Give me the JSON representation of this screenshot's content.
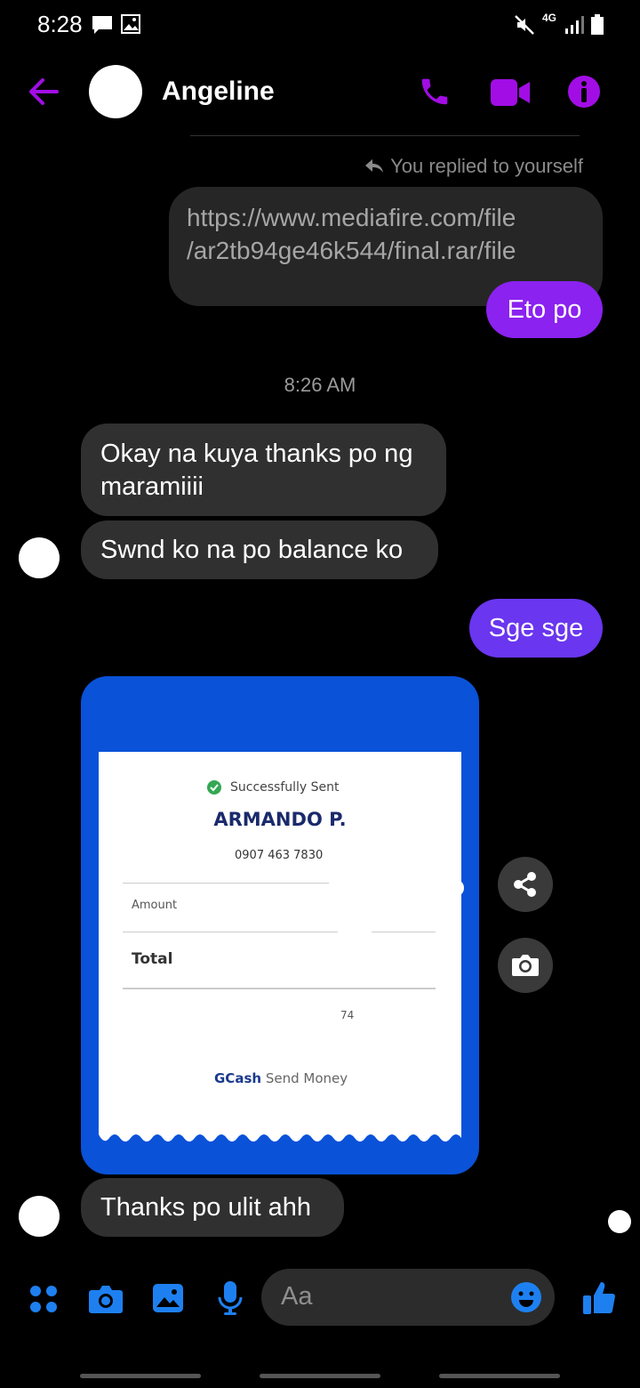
{
  "status_bar": {
    "time": "8:28",
    "network": "4G",
    "icons": [
      "chat-icon",
      "image-icon",
      "mute-icon",
      "signal-icon",
      "battery-icon"
    ]
  },
  "header": {
    "contact_name": "Angeline",
    "accent_color": "#a20de6"
  },
  "thread": {
    "reply_note": "You replied to yourself",
    "quoted_link_line1": "https://www.mediafire.com/file",
    "quoted_link_line2": "/ar2tb94ge46k544/final.rar/file",
    "sent_1": "Eto po",
    "timestamp": "8:26 AM",
    "received_1_line1": "Okay na kuya thanks po ng",
    "received_1_line2": "maramiiii",
    "received_2": "Swnd ko na po balance ko",
    "sent_2": "Sge sge",
    "receipt": {
      "status": "Successfully Sent",
      "recipient": "ARMANDO P.",
      "number": "0907 463 7830",
      "amount_label": "Amount",
      "total_label": "Total",
      "ref_fragment": "74",
      "brand": "GCash",
      "service": "Send Money"
    },
    "received_3": "Thanks po ulit ahh"
  },
  "composer": {
    "placeholder": "Aa"
  }
}
